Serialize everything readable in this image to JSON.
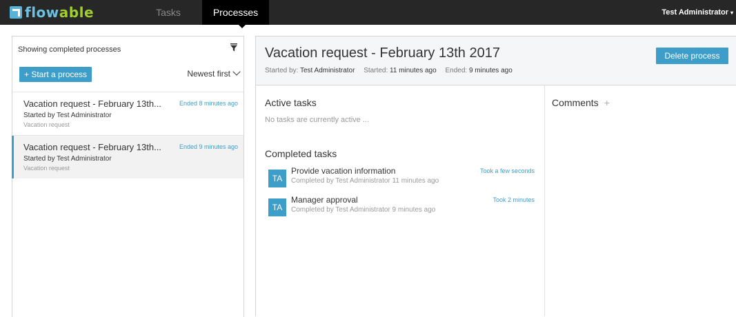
{
  "app": {
    "logo_prefix": "flow",
    "logo_suffix": "able"
  },
  "nav": {
    "tabs": [
      {
        "label": "Tasks",
        "active": false
      },
      {
        "label": "Processes",
        "active": true
      }
    ],
    "user": "Test Administrator"
  },
  "list": {
    "header": "Showing completed processes",
    "start_label": "+ Start a process",
    "sort_label": "Newest first",
    "items": [
      {
        "title": "Vacation request - February 13th...",
        "ended": "Ended 8 minutes ago",
        "started_by": "Started by Test Administrator",
        "definition": "Vacation request",
        "selected": false
      },
      {
        "title": "Vacation request - February 13th...",
        "ended": "Ended 9 minutes ago",
        "started_by": "Started by Test Administrator",
        "definition": "Vacation request",
        "selected": true
      }
    ]
  },
  "detail": {
    "title": "Vacation request - February 13th 2017",
    "started_by_label": "Started by:",
    "started_by_value": "Test Administrator",
    "started_label": "Started:",
    "started_value": "11 minutes ago",
    "ended_label": "Ended:",
    "ended_value": "9 minutes ago",
    "delete_label": "Delete process",
    "active_tasks_title": "Active tasks",
    "no_active_tasks": "No tasks are currently active ...",
    "completed_tasks_title": "Completed tasks",
    "completed_tasks": [
      {
        "initials": "TA",
        "name": "Provide vacation information",
        "sub": "Completed by Test Administrator 11 minutes ago",
        "duration": "Took a few seconds"
      },
      {
        "initials": "TA",
        "name": "Manager approval",
        "sub": "Completed by Test Administrator 9 minutes ago",
        "duration": "Took 2 minutes"
      }
    ],
    "comments_title": "Comments",
    "comments_add": "+"
  },
  "colors": {
    "accent": "#3c9ec9",
    "topbar": "#272727",
    "logo_blue": "#6cc0e0",
    "logo_green": "#9fce2e"
  }
}
